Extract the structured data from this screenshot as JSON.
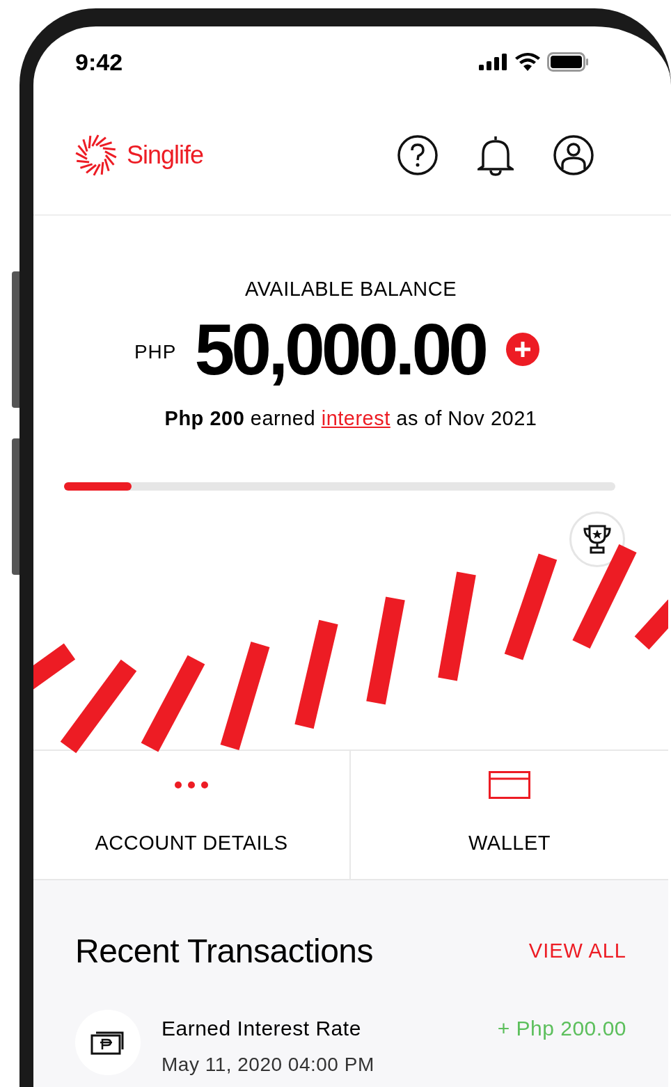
{
  "status_bar": {
    "time": "9:42"
  },
  "header": {
    "brand": "Singlife"
  },
  "balance": {
    "title": "AVAILABLE BALANCE",
    "currency": "PHP",
    "amount": "50,000.00",
    "note_prefix": "**Php 200** earned",
    "note_link": "interest",
    "note_suffix": "as of Nov 2021",
    "progress": {
      "level": 0.123
    }
  },
  "actions": [
    {
      "kind": "more",
      "label": "ACCOUNT DETAILS"
    },
    {
      "kind": "wallet",
      "label": "WALLET"
    }
  ],
  "transactions": {
    "title": "Recent Transactions",
    "view_all": "VIEW ALL",
    "rows": [
      {
        "title": "Earned Interest Rate",
        "date": "May 11, 2020 04:00 PM",
        "amount": "+ Php 200.00"
      }
    ]
  }
}
